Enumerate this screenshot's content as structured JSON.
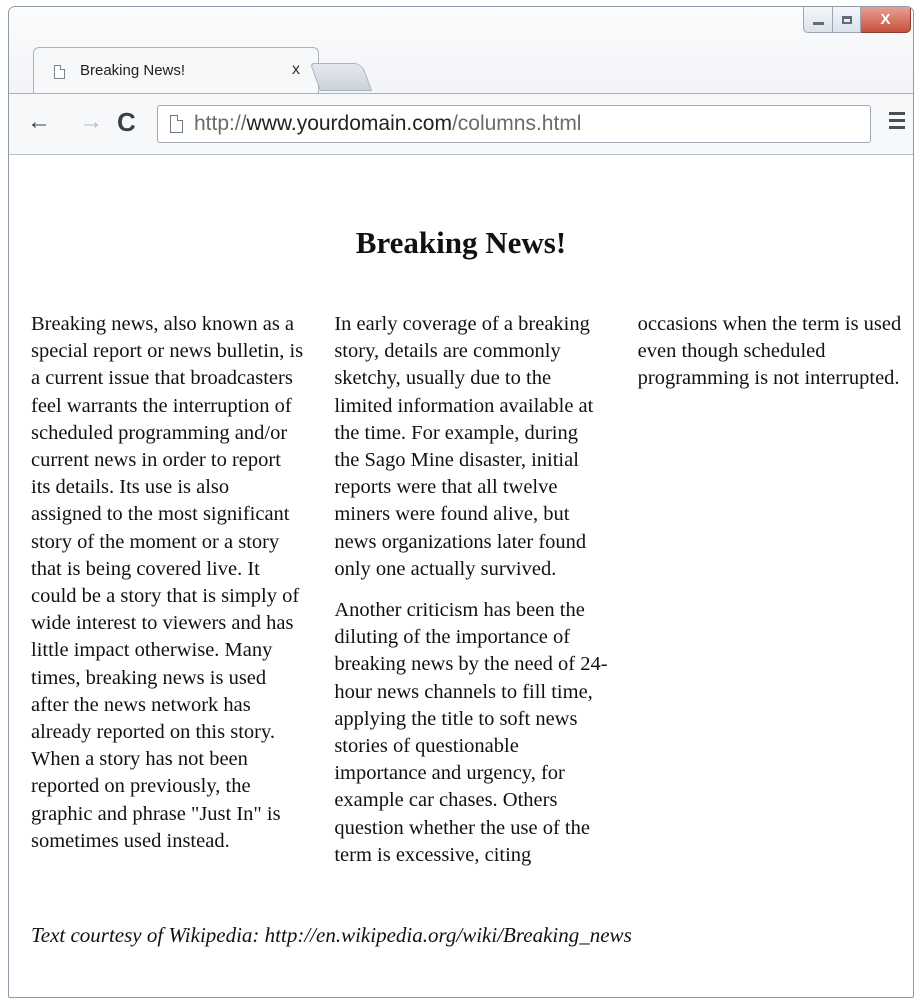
{
  "browser": {
    "tab_title": "Breaking News!",
    "tab_close": "x",
    "url_prefix": "http://",
    "url_host": "www.yourdomain.com",
    "url_path": "/columns.html",
    "nav": {
      "back": "←",
      "forward": "→",
      "reload": "C"
    },
    "window_close": "X"
  },
  "page": {
    "headline": "Breaking News!",
    "paragraphs": [
      "Breaking news, also known as a special report or news bulletin, is a current issue that broadcasters feel warrants the interruption of scheduled programming and/or current news in order to report its details. Its use is also assigned to the most significant story of the moment or a story that is being covered live. It could be a story that is simply of wide interest to viewers and has little impact otherwise. Many times, breaking news is used after the news network has already reported on this story. When a story has not been reported on previously, the graphic and phrase \"Just In\" is sometimes used instead.",
      "In early coverage of a breaking story, details are commonly sketchy, usually due to the limited information available at the time. For example, during the Sago Mine disaster, initial reports were that all twelve miners were found alive, but news organizations later found only one actually survived.",
      "Another criticism has been the diluting of the importance of breaking news by the need of 24-hour news channels to fill time, applying the title to soft news stories of questionable importance and urgency, for example car chases. Others question whether the use of the term is excessive, citing occasions when the term is used even though scheduled programming is not interrupted."
    ],
    "credit": "Text courtesy of Wikipedia: http://en.wikipedia.org/wiki/Breaking_news"
  }
}
